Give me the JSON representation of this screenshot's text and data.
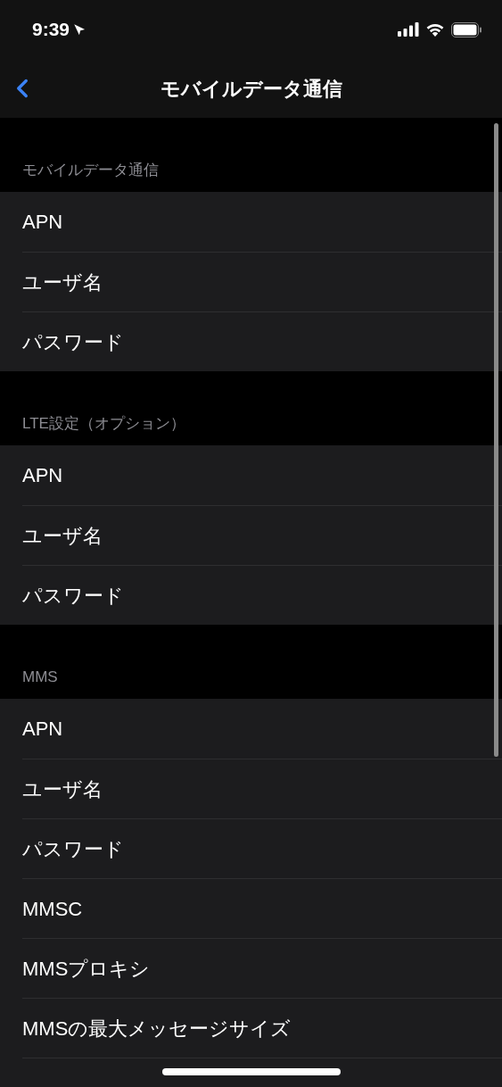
{
  "status_bar": {
    "time": "9:39"
  },
  "nav": {
    "title": "モバイルデータ通信"
  },
  "sections": [
    {
      "header": "モバイルデータ通信",
      "rows": [
        {
          "label": "APN"
        },
        {
          "label": "ユーザ名"
        },
        {
          "label": "パスワード"
        }
      ]
    },
    {
      "header": "LTE設定（オプション）",
      "rows": [
        {
          "label": "APN"
        },
        {
          "label": "ユーザ名"
        },
        {
          "label": "パスワード"
        }
      ]
    },
    {
      "header": "MMS",
      "rows": [
        {
          "label": "APN"
        },
        {
          "label": "ユーザ名"
        },
        {
          "label": "パスワード"
        },
        {
          "label": "MMSC"
        },
        {
          "label": "MMSプロキシ"
        },
        {
          "label": "MMSの最大メッセージサイズ"
        }
      ]
    }
  ]
}
